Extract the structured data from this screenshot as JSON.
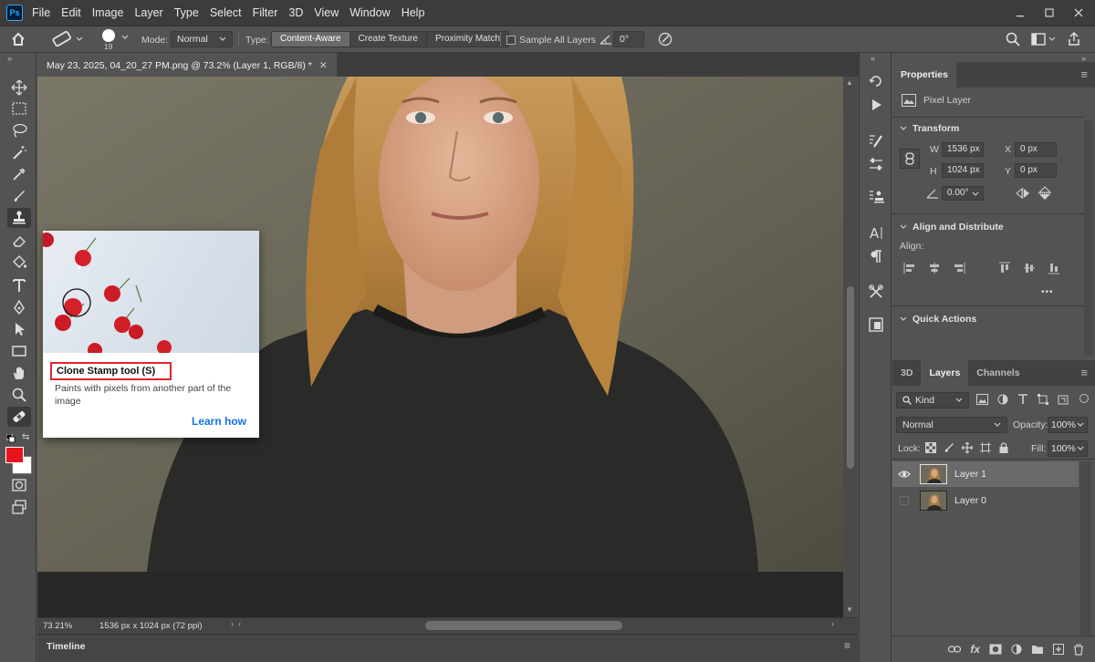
{
  "app": {
    "logo": "Ps",
    "menus": [
      "File",
      "Edit",
      "Image",
      "Layer",
      "Type",
      "Select",
      "Filter",
      "3D",
      "View",
      "Window",
      "Help"
    ]
  },
  "options_bar": {
    "brush_size": "19",
    "mode_label": "Mode:",
    "mode_value": "Normal",
    "type_label": "Type:",
    "type_options": [
      "Content-Aware",
      "Create Texture",
      "Proximity Match"
    ],
    "type_selected": "Content-Aware",
    "sample_all_layers": "Sample All Layers",
    "angle_value": "0°"
  },
  "document": {
    "tab_title": "May 23, 2025, 04_20_27 PM.png @ 73.2% (Layer 1, RGB/8) *",
    "zoom": "73.21%",
    "dimensions": "1536 px x 1024 px (72 ppi)",
    "timeline_label": "Timeline"
  },
  "tooltip": {
    "title": "Clone Stamp tool (S)",
    "description": "Paints with pixels from another part of the image",
    "link": "Learn how"
  },
  "properties": {
    "tab": "Properties",
    "layer_type": "Pixel Layer",
    "transform_label": "Transform",
    "w_label": "W",
    "w_value": "1536 px",
    "h_label": "H",
    "h_value": "1024 px",
    "x_label": "X",
    "x_value": "0 px",
    "y_label": "Y",
    "y_value": "0 px",
    "angle_value": "0.00°",
    "align_section": "Align and Distribute",
    "align_label": "Align:",
    "more": "•••",
    "quick_actions": "Quick Actions"
  },
  "layers": {
    "tabs": [
      "3D",
      "Layers",
      "Channels"
    ],
    "active_tab": "Layers",
    "filter_kind": "Kind",
    "blend_mode": "Normal",
    "opacity_label": "Opacity:",
    "opacity_value": "100%",
    "lock_label": "Lock:",
    "fill_label": "Fill:",
    "fill_value": "100%",
    "items": [
      {
        "name": "Layer 1",
        "visible": true,
        "selected": true
      },
      {
        "name": "Layer 0",
        "visible": false,
        "selected": false
      }
    ]
  },
  "colors": {
    "foreground": "#e8141c",
    "background": "#ffffff",
    "tooltip_highlight": "#e0252f",
    "link": "#1473e6"
  }
}
